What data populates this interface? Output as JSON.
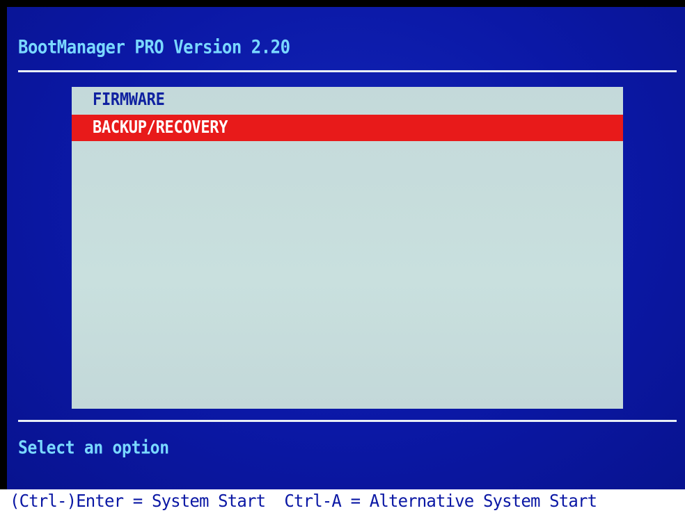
{
  "app": {
    "title": "BootManager PRO Version 2.20"
  },
  "menu": {
    "items": [
      {
        "label": "FIRMWARE",
        "selected": false
      },
      {
        "label": "BACKUP/RECOVERY",
        "selected": true
      }
    ]
  },
  "status": {
    "prompt": "Select an option"
  },
  "footer": {
    "shortcut_enter": "(Ctrl-)Enter = System Start",
    "shortcut_ctrl_a": "Ctrl-A = Alternative System Start"
  },
  "colors": {
    "background": "#0a17a4",
    "title_text": "#7ad8ff",
    "panel": "#c6dcdc",
    "selection": "#e81a1a",
    "footer_bg": "#ffffff"
  }
}
